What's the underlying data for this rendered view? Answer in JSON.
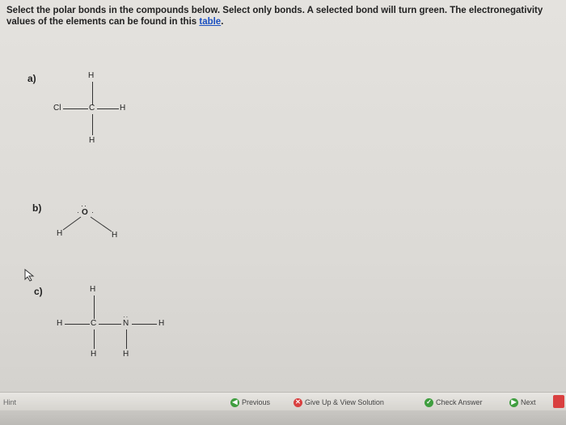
{
  "instructions": {
    "text": "Select the polar bonds in the compounds below. Select only bonds. A selected bond will turn green. The electronegativity values of the elements can be found in this ",
    "link": "table",
    "end": "."
  },
  "compounds": {
    "a": {
      "label": "a)",
      "atoms": {
        "top": "H",
        "left": "Cl",
        "center": "C",
        "right": "H",
        "bottom": "H"
      }
    },
    "b": {
      "label": "b)",
      "atoms": {
        "center": "O",
        "left": "H",
        "right": "H"
      }
    },
    "c": {
      "label": "c)",
      "atoms": {
        "top": "H",
        "left": "H",
        "c": "C",
        "n": "N",
        "right": "H",
        "bottom1": "H",
        "bottom2": "H"
      }
    }
  },
  "footer": {
    "hint": "Hint",
    "previous": "Previous",
    "give_up": "Give Up & View Solution",
    "check": "Check Answer",
    "next": "Next"
  },
  "colors": {
    "link": "#1a4fc0",
    "previous_icon": "#3f9e3f",
    "giveup_icon": "#d94040",
    "check_icon": "#3f9e3f",
    "next_icon": "#3f9e3f"
  }
}
